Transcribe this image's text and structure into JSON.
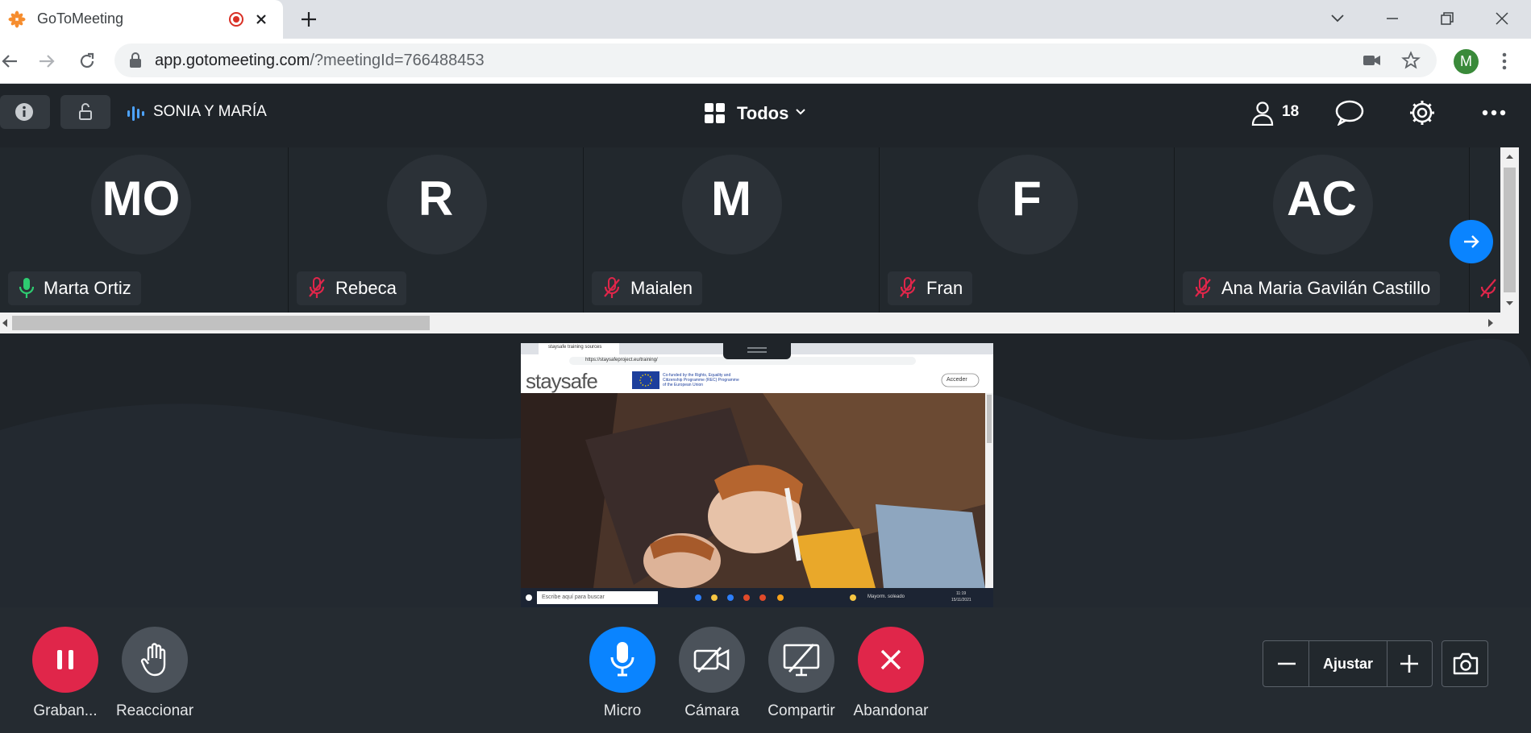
{
  "browser": {
    "tab_title": "GoToMeeting",
    "url_host": "app.gotomeeting.com",
    "url_path": "/?meetingId=766488453",
    "profile_initial": "M"
  },
  "header": {
    "meeting_name": "SONIA Y MARÍA",
    "layout_label": "Todos",
    "people_count": "18"
  },
  "participants": [
    {
      "initials": "MO",
      "name": "Marta Ortiz",
      "mic": "on"
    },
    {
      "initials": "R",
      "name": "Rebeca",
      "mic": "muted"
    },
    {
      "initials": "M",
      "name": "Maialen",
      "mic": "muted"
    },
    {
      "initials": "F",
      "name": "Fran",
      "mic": "muted"
    },
    {
      "initials": "AC",
      "name": "Ana Maria Gavilán Castillo",
      "mic": "muted"
    }
  ],
  "shared_screen": {
    "tab_text": "staysafe training sources",
    "url_text": "https://staysafeproject.eu/training/",
    "logo_text": "staysafe",
    "eu_text": "Co-funded by the Rights, Equality and Citizenship Programme (REC) Programme of the European Union",
    "button_text": "Acceder",
    "search_text": "Escribe aquí para buscar",
    "weather_text": "Mayorm. soleado",
    "clock_text": "11:19",
    "date_text": "15/11/2021"
  },
  "controls": {
    "record_label": "Graban...",
    "react_label": "Reaccionar",
    "mic_label": "Micro",
    "camera_label": "Cámara",
    "share_label": "Compartir",
    "leave_label": "Abandonar",
    "zoom_label": "Ajustar"
  },
  "colors": {
    "record": "#e0264a",
    "mic": "#0a84ff",
    "leave": "#e0264a",
    "neutral_button": "#4b525a",
    "mic_on": "#2ecc71",
    "mic_muted": "#e0264a"
  }
}
